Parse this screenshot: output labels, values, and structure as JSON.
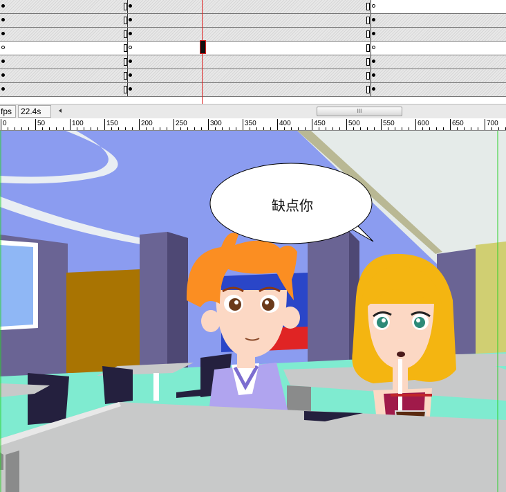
{
  "timeline": {
    "layers": [
      {
        "left_key": "filled",
        "mid_key": "filled",
        "right_key": "hollow",
        "right_white": true
      },
      {
        "left_key": "filled",
        "mid_key": "filled",
        "right_key": "filled",
        "right_white": false
      },
      {
        "left_key": "filled",
        "mid_key": "filled",
        "right_key": "filled",
        "right_white": false
      },
      {
        "left_key": "hollow",
        "mid_key": "hollow",
        "right_key": "hollow",
        "right_white": true,
        "selected": true
      },
      {
        "left_key": "filled",
        "mid_key": "filled",
        "right_key": "filled",
        "right_white": false
      },
      {
        "left_key": "filled",
        "mid_key": "filled",
        "right_key": "filled",
        "right_white": false
      },
      {
        "left_key": "filled",
        "mid_key": "filled",
        "right_key": "filled",
        "right_white": false
      }
    ]
  },
  "statusbar": {
    "fps_label": "fps",
    "time": "22.4s",
    "scroll_left_icon": "triangle-left-icon",
    "thumb_grip": "III"
  },
  "ruler": {
    "labels": [
      "0",
      "50",
      "100",
      "150",
      "200",
      "250",
      "300",
      "350",
      "400",
      "450",
      "500",
      "550",
      "600",
      "650",
      "700"
    ]
  },
  "stage": {
    "speech_bubble": "缺点你",
    "colors": {
      "sky_wall": "#8b9cf0",
      "floor": "#7febd0",
      "table": "#c8c9c9",
      "pillar": "#6a6494",
      "boy_hair": "#fb8e22",
      "girl_hair": "#f4b511",
      "boy_shirt": "#b0a4ef",
      "girl_top": "#a01a4a"
    }
  }
}
